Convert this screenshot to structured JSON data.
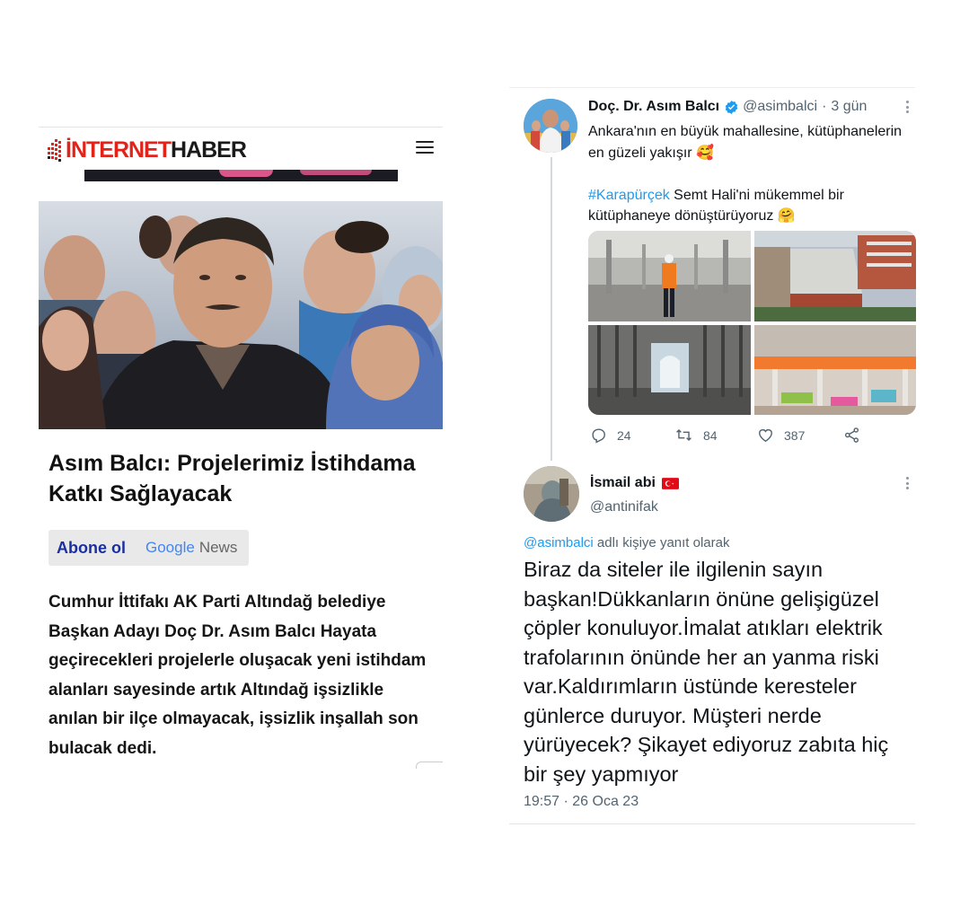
{
  "news": {
    "logo_red": "İNTERNET",
    "logo_black": "HABER",
    "headline": "Asım Balcı: Projelerimiz İstihdama Katkı Sağlayacak",
    "follow_label": "Abone ol",
    "google_word": "Google",
    "news_word": "News",
    "body": "Cumhur İttifakı AK Parti Altındağ belediye Başkan Adayı Doç Dr. Asım Balcı Hayata geçirecekleri projelerle oluşacak yeni istihdam alanları sayesinde artık Altındağ işsizlikle anılan bir ilçe olmayacak, işsizlik inşallah son bulacak dedi.",
    "brand_red": "#e2231a"
  },
  "tweet1": {
    "author": "Doç. Dr. Asım Balcı",
    "handle": "@asimbalci",
    "separator": "·",
    "age": "3 gün",
    "line1": "Ankara'nın en büyük mahallesine, kütüphanelerin en güzeli yakışır 🥰",
    "hashtag": "#Karapürçek",
    "line2": " Semt Hali'ni mükemmel bir kütüphaneye dönüştürüyoruz 🤗",
    "replies": "24",
    "retweets": "84",
    "likes": "387",
    "accent": "#1d9bf0"
  },
  "tweet2": {
    "author": "İsmail abi",
    "handle": "@antinifak",
    "reply_mention": "@asimbalci",
    "reply_suffix": " adlı kişiye yanıt olarak",
    "text": "Biraz da siteler ile ilgilenin sayın başkan!Dükkanların önüne gelişigüzel çöpler konuluyor.İmalat atıkları elektrik trafolarının önünde her an yanma riski var.Kaldırımların üstünde keresteler günlerce duruyor. Müşteri nerde yürüyecek? Şikayet ediyoruz zabıta hiç bir şey yapmıyor",
    "timestamp": "19:57 · 26 Oca 23"
  }
}
